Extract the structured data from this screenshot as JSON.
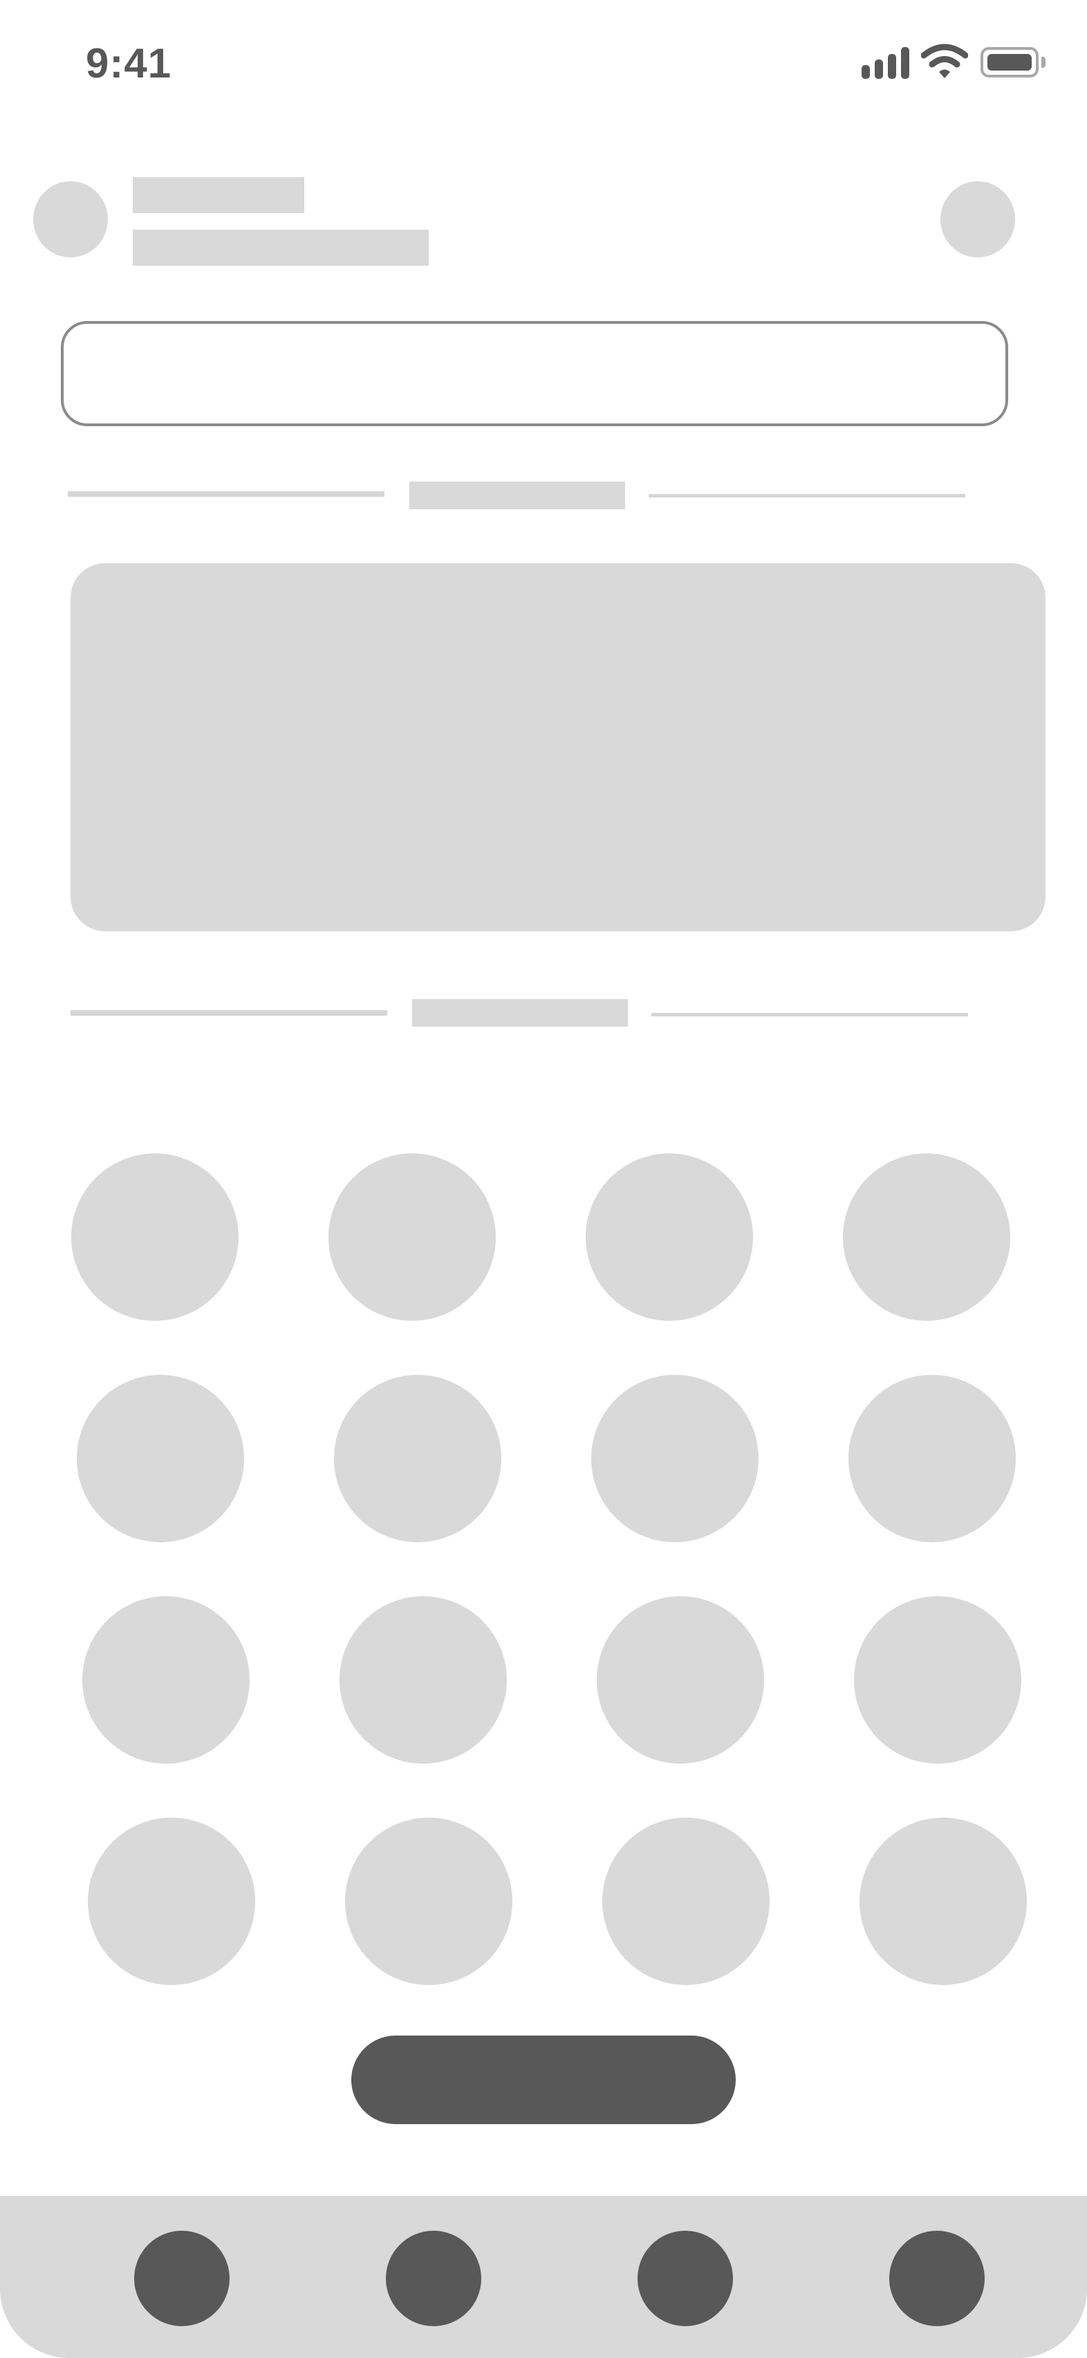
{
  "status_bar": {
    "time": "9:41",
    "signal_icon": "cellular-signal-icon",
    "wifi_icon": "wifi-icon",
    "battery_icon": "battery-icon"
  },
  "colors": {
    "placeholder": "#d9d9d9",
    "dark": "#585858",
    "field_border": "#8a8a8a",
    "background": "#ffffff"
  },
  "search": {
    "value": ""
  },
  "grid": {
    "rows": 4,
    "columns": 4
  },
  "bottom_nav": {
    "item_count": 4
  }
}
